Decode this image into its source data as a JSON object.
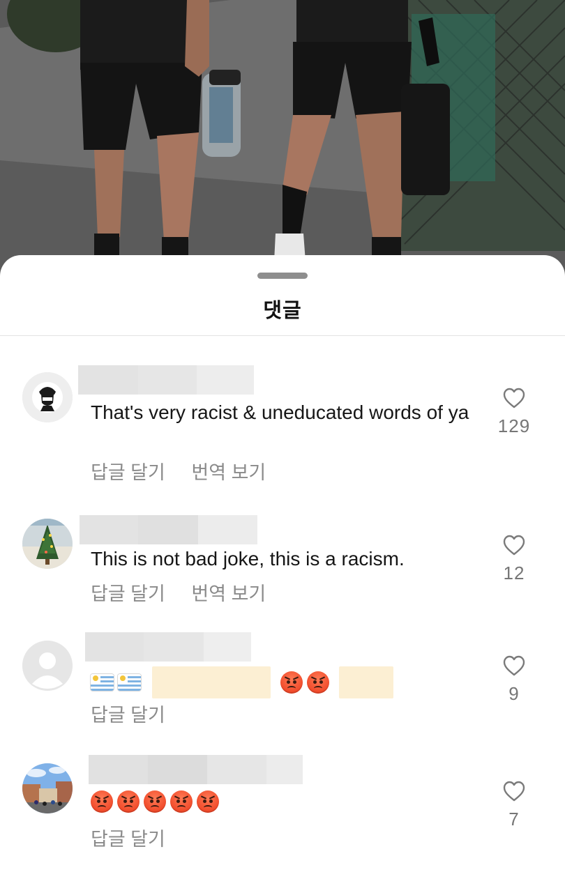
{
  "sheet": {
    "title": "댓글"
  },
  "comments": [
    {
      "text": "That's very racist & uneducated words of ya",
      "reply_label": "답글 달기",
      "translate_label": "번역 보기",
      "likes": "129"
    },
    {
      "text": "This is not bad joke, this is a racism.",
      "reply_label": "답글 달기",
      "translate_label": "번역 보기",
      "likes": "12"
    },
    {
      "text": "",
      "reply_label": "답글 달기",
      "likes": "9"
    },
    {
      "text": "",
      "reply_label": "답글 달기",
      "likes": "7"
    }
  ],
  "colors": {
    "accent_text": "#161616",
    "secondary_text": "#8a8a8a",
    "like_count": "#767676",
    "emoji_angry": "#f04a2a"
  },
  "icons": [
    "heart-outline-icon",
    "default-avatar-icon",
    "angry-face-emoji",
    "uruguay-flag-emoji"
  ]
}
